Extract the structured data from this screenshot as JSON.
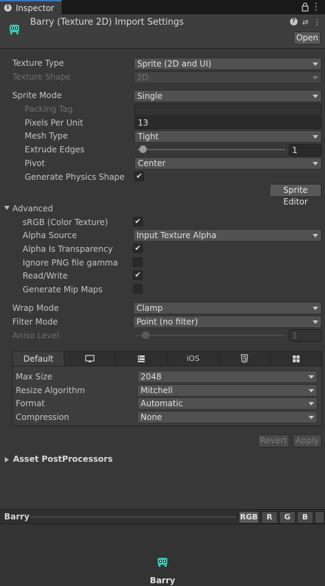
{
  "tab": {
    "label": "Inspector"
  },
  "header": {
    "title": "Barry (Texture 2D) Import Settings",
    "open_button": "Open"
  },
  "texture_type": {
    "label": "Texture Type",
    "value": "Sprite (2D and UI)"
  },
  "texture_shape": {
    "label": "Texture Shape",
    "value": "2D"
  },
  "sprite_mode": {
    "label": "Sprite Mode",
    "value": "Single"
  },
  "packing_tag": {
    "label": "Packing Tag",
    "value": ""
  },
  "pixels_per_unit": {
    "label": "Pixels Per Unit",
    "value": "13"
  },
  "mesh_type": {
    "label": "Mesh Type",
    "value": "Tight"
  },
  "extrude_edges": {
    "label": "Extrude Edges",
    "value": "1"
  },
  "pivot": {
    "label": "Pivot",
    "value": "Center"
  },
  "generate_physics_shape": {
    "label": "Generate Physics Shape",
    "checked": true,
    "check_glyph": "✔"
  },
  "sprite_editor_button": "Sprite Editor",
  "advanced": {
    "label": "Advanced",
    "srgb": {
      "label": "sRGB (Color Texture)",
      "checked": true
    },
    "alpha_source": {
      "label": "Alpha Source",
      "value": "Input Texture Alpha"
    },
    "alpha_is_transparency": {
      "label": "Alpha Is Transparency",
      "checked": true
    },
    "ignore_png_gamma": {
      "label": "Ignore PNG file gamma",
      "checked": false
    },
    "read_write": {
      "label": "Read/Write",
      "checked": true
    },
    "generate_mip_maps": {
      "label": "Generate Mip Maps",
      "checked": false
    },
    "check_glyph": "✔"
  },
  "wrap_mode": {
    "label": "Wrap Mode",
    "value": "Clamp"
  },
  "filter_mode": {
    "label": "Filter Mode",
    "value": "Point (no filter)"
  },
  "aniso_level": {
    "label": "Aniso Level",
    "value": "1"
  },
  "platforms": {
    "tabs": [
      "Default",
      "monitor-icon",
      "server-icon",
      "iOS",
      "html5-icon",
      "windows-icon"
    ],
    "default_label": "Default",
    "ios_label": "iOS",
    "max_size": {
      "label": "Max Size",
      "value": "2048"
    },
    "resize_algorithm": {
      "label": "Resize Algorithm",
      "value": "Mitchell"
    },
    "format": {
      "label": "Format",
      "value": "Automatic"
    },
    "compression": {
      "label": "Compression",
      "value": "None"
    }
  },
  "revert_button": "Revert",
  "apply_button": "Apply",
  "asset_postprocessors": {
    "label": "Asset PostProcessors"
  },
  "preview": {
    "name": "Barry",
    "channels": [
      "RGB",
      "R",
      "G",
      "B"
    ],
    "caption": "Barry"
  },
  "colors": {
    "accent": "#3a79bb",
    "background": "#383838",
    "sprite": "#3cc9b5"
  }
}
